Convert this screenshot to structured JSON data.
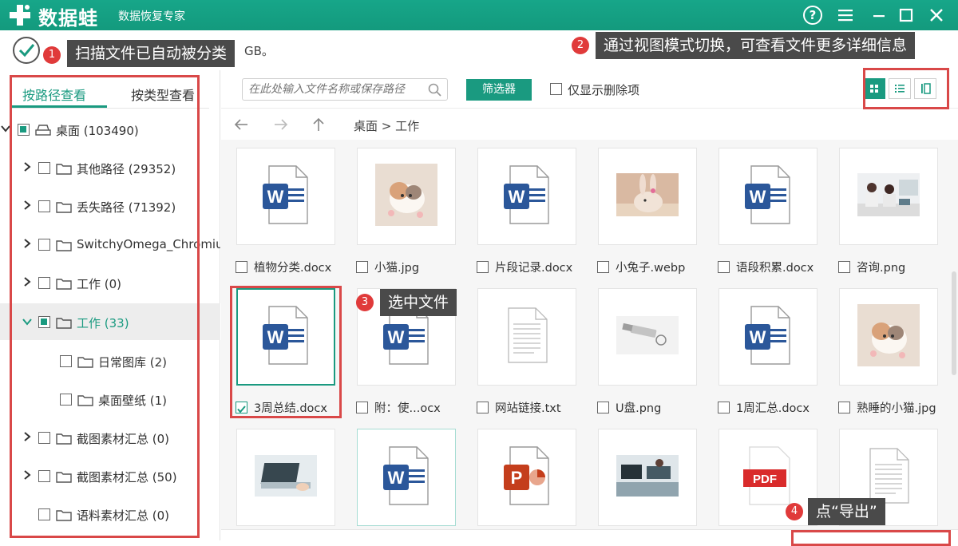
{
  "app": {
    "name": "数据蛙",
    "subtitle": "数据恢复专家",
    "accent_color": "#1a9a80"
  },
  "status": {
    "text_visible_tail": "GB。"
  },
  "callouts": [
    {
      "num": "1",
      "text": "扫描文件已自动被分类"
    },
    {
      "num": "2",
      "text": "通过视图模式切换，可查看文件更多详细信息"
    },
    {
      "num": "3",
      "text": "选中文件"
    },
    {
      "num": "4",
      "text": "点“导出”"
    }
  ],
  "sidebar": {
    "tabs": [
      "按路径查看",
      "按类型查看"
    ],
    "tree": [
      {
        "label": "桌面 (103490)",
        "expanded": true,
        "icon": "drive-icon"
      },
      {
        "label": "其他路径 (29352)",
        "icon": "folder-icon"
      },
      {
        "label": "丢失路径 (71392)",
        "icon": "folder-icon"
      },
      {
        "label": "SwitchyOmega_Chromiur",
        "icon": "folder-icon"
      },
      {
        "label": "工作 (0)",
        "icon": "folder-icon"
      },
      {
        "label": "工作 (33)",
        "icon": "folder-icon",
        "selected": true
      },
      {
        "label": "日常图库 (2)",
        "icon": "folder-icon"
      },
      {
        "label": "桌面壁纸 (1)",
        "icon": "folder-icon"
      },
      {
        "label": "截图素材汇总 (0)",
        "icon": "folder-icon"
      },
      {
        "label": "截图素材汇总 (50)",
        "icon": "folder-icon"
      },
      {
        "label": "语料素材汇总 (0)",
        "icon": "folder-icon"
      }
    ]
  },
  "toolbar": {
    "search_placeholder": "在此处输入文件名称或保存路径",
    "filter_label": "筛选器",
    "deleted_only_label": "仅显示删除项"
  },
  "nav": {
    "breadcrumb": "桌面 > 工作"
  },
  "files": [
    {
      "name": "植物分类.docx",
      "icon": "word-icon"
    },
    {
      "name": "小猫.jpg",
      "icon": "kitten-photo"
    },
    {
      "name": "片段记录.docx",
      "icon": "word-icon"
    },
    {
      "name": "小兔子.webp",
      "icon": "rabbit-photo"
    },
    {
      "name": "语段积累.docx",
      "icon": "word-icon"
    },
    {
      "name": "咨询.png",
      "icon": "office-photo"
    },
    {
      "name": "3周总结.docx",
      "icon": "word-icon",
      "checked": true
    },
    {
      "name": "附：使...ocx",
      "icon": "word-icon"
    },
    {
      "name": "网站链接.txt",
      "icon": "text-file-icon"
    },
    {
      "name": "U盘.png",
      "icon": "usb-photo"
    },
    {
      "name": "1周汇总.docx",
      "icon": "word-icon"
    },
    {
      "name": "熟睡的小猫.jpg",
      "icon": "kitten-photo"
    },
    {
      "name": "",
      "icon": "laptop-photo"
    },
    {
      "name": "",
      "icon": "word-icon"
    },
    {
      "name": "",
      "icon": "powerpoint-icon"
    },
    {
      "name": "",
      "icon": "desk-photo"
    },
    {
      "name": "",
      "icon": "pdf-icon"
    },
    {
      "name": "",
      "icon": "text-file-icon"
    }
  ]
}
